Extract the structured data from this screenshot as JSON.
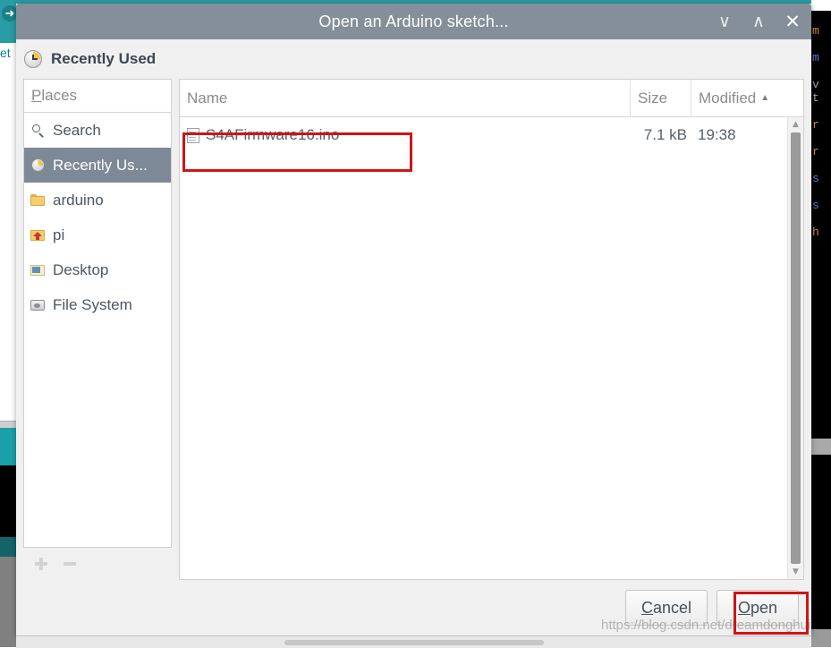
{
  "window": {
    "title": "Open an Arduino sketch...",
    "controls": [
      {
        "name": "minimize",
        "glyph": "∨"
      },
      {
        "name": "maximize",
        "glyph": "∧"
      },
      {
        "name": "close",
        "glyph": "✕"
      }
    ]
  },
  "location": {
    "icon": "clock-icon",
    "label": "Recently Used"
  },
  "places": {
    "header": "Places",
    "header_mnemonic": "P",
    "header_rest": "laces",
    "items": [
      {
        "label": "Search",
        "icon": "search-icon",
        "selected": false
      },
      {
        "label": "Recently Us...",
        "icon": "clock-icon",
        "selected": true
      },
      {
        "label": "arduino",
        "icon": "folder-icon",
        "selected": false
      },
      {
        "label": "pi",
        "icon": "home-icon",
        "selected": false
      },
      {
        "label": "Desktop",
        "icon": "desktop-icon",
        "selected": false
      },
      {
        "label": "File System",
        "icon": "drive-icon",
        "selected": false
      }
    ],
    "add_label": "+",
    "remove_label": "−"
  },
  "file_list": {
    "columns": [
      {
        "key": "name",
        "label": "Name",
        "sorted": false
      },
      {
        "key": "size",
        "label": "Size",
        "sorted": false
      },
      {
        "key": "modified",
        "label": "Modified",
        "sorted": true,
        "sort_arrow": "▲"
      }
    ],
    "rows": [
      {
        "icon": "text-file-icon",
        "name": "S4AFirmware16.ino",
        "size": "7.1 kB",
        "modified": "19:38",
        "highlighted": true
      }
    ],
    "scrollbar": {
      "up_arrow": "▲",
      "down_arrow": "▼"
    }
  },
  "actions": {
    "cancel": {
      "mnemonic": "C",
      "rest": "ancel"
    },
    "open": {
      "mnemonic": "O",
      "rest": "pen",
      "highlighted": true
    }
  },
  "watermark": "https://blog.csdn.net/dreamdonghui",
  "background_editor": {
    "left_tab_text": "et",
    "code_lines": [
      "m",
      "",
      "m",
      "v",
      "t",
      "",
      "r",
      "",
      "r",
      "",
      "s",
      "",
      "s",
      "",
      "h"
    ]
  },
  "colors": {
    "titlebar": "#848f99",
    "selection": "#7d8996",
    "annotation": "#d01414",
    "dialog_bg": "#f0f0f0",
    "ide_teal": "#2a9ca5",
    "text": "#4c5662"
  }
}
